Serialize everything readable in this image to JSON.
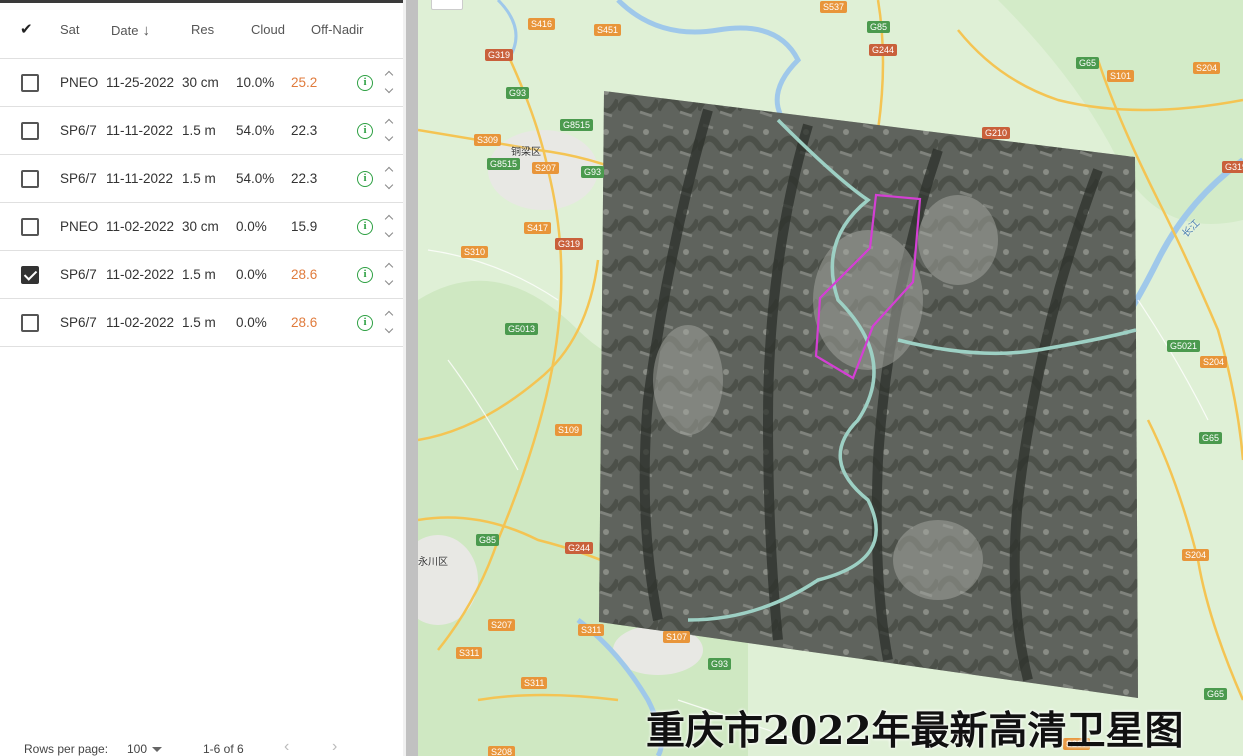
{
  "table": {
    "header": {
      "select_all": "✔",
      "sat": "Sat",
      "date": "Date",
      "sort_arrow": "↓",
      "res": "Res",
      "cloud": "Cloud",
      "off_nadir": "Off-Nadir"
    },
    "rows": [
      {
        "checked": false,
        "sat": "PNEO",
        "date": "11-25-2022",
        "res": "30 cm",
        "cloud": "10.0%",
        "off_nadir": "25.2",
        "warn": true
      },
      {
        "checked": false,
        "sat": "SP6/7",
        "date": "11-11-2022",
        "res": "1.5 m",
        "cloud": "54.0%",
        "off_nadir": "22.3",
        "warn": false
      },
      {
        "checked": false,
        "sat": "SP6/7",
        "date": "11-11-2022",
        "res": "1.5 m",
        "cloud": "54.0%",
        "off_nadir": "22.3",
        "warn": false
      },
      {
        "checked": false,
        "sat": "PNEO",
        "date": "11-02-2022",
        "res": "30 cm",
        "cloud": "0.0%",
        "off_nadir": "15.9",
        "warn": false
      },
      {
        "checked": true,
        "sat": "SP6/7",
        "date": "11-02-2022",
        "res": "1.5 m",
        "cloud": "0.0%",
        "off_nadir": "28.6",
        "warn": true
      },
      {
        "checked": false,
        "sat": "SP6/7",
        "date": "11-02-2022",
        "res": "1.5 m",
        "cloud": "0.0%",
        "off_nadir": "28.6",
        "warn": true
      }
    ],
    "info_icon": "i",
    "footer": {
      "rows_per_page_label": "Rows per page:",
      "rows_per_page_value": "100",
      "range": "1-6 of 6",
      "prev": "‹",
      "next": "›"
    }
  },
  "colors": {
    "warn": "#e07b3c",
    "ok": "#333333",
    "info": "#2ea043",
    "aoi": "#d43fd4"
  },
  "map": {
    "title": "重庆市2022年最新高清卫星图",
    "places": {
      "tongliang": "铜梁区",
      "yongchuan": "永川区",
      "changjiang": "长江"
    },
    "road_labels": {
      "s416": "S416",
      "s451": "S451",
      "s537": "S537",
      "g85a": "G85",
      "g244a": "G244",
      "g65a": "G65",
      "s101": "S101",
      "s204a": "S204",
      "g319a": "G319",
      "g93a": "G93",
      "g8515a": "G8515",
      "s309": "S309",
      "g8515b": "G8515",
      "s207a": "S207",
      "g93b": "G93",
      "g210": "G210",
      "g319b": "G319",
      "s417": "S417",
      "g319c": "G319",
      "s310": "S310",
      "g5013": "G5013",
      "g5021": "G5021",
      "s204b": "S204",
      "s109": "S109",
      "g65b": "G65",
      "g85b": "G85",
      "g244b": "G244",
      "s204c": "S204",
      "s207b": "S207",
      "s311a": "S311",
      "s107": "S107",
      "s311b": "S311",
      "g93c": "G93",
      "s311c": "S311",
      "s208": "S208",
      "g65c": "G65",
      "s207c": "S207"
    }
  }
}
